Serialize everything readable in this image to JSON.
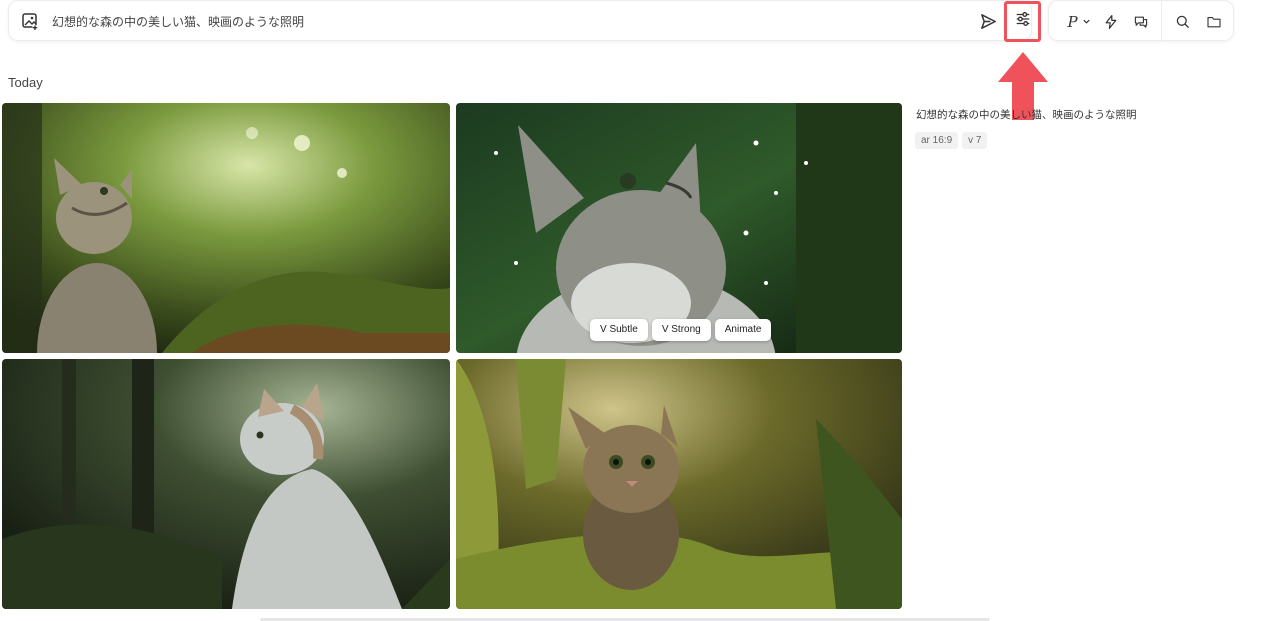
{
  "prompt_bar": {
    "prompt_text": "幻想的な森の中の美しい猫、映画のような照明",
    "icons": [
      "image-add-icon",
      "send-icon",
      "sliders-icon"
    ],
    "settings_highlight_color": "#f0525b"
  },
  "toolbar": {
    "personalize_label": "P",
    "icons": [
      "chevron-down-icon",
      "lightning-icon",
      "chat-icon",
      "search-icon",
      "folder-icon"
    ]
  },
  "annotation": {
    "arrow_color": "#f0525b"
  },
  "section": {
    "title": "Today"
  },
  "images": [
    {
      "subject": "tabby cat looking up in sunlit forest"
    },
    {
      "subject": "tabby cat looking up with falling particles"
    },
    {
      "subject": "white and gray cat in dark forest"
    },
    {
      "subject": "tabby kitten in mossy forest"
    }
  ],
  "image_actions": {
    "vary_subtle": "V Subtle",
    "vary_strong": "V Strong",
    "animate": "Animate"
  },
  "meta": {
    "prompt": "幻想的な森の中の美しい猫、映画のような照明",
    "tags": [
      "ar 16:9",
      "v 7"
    ]
  }
}
